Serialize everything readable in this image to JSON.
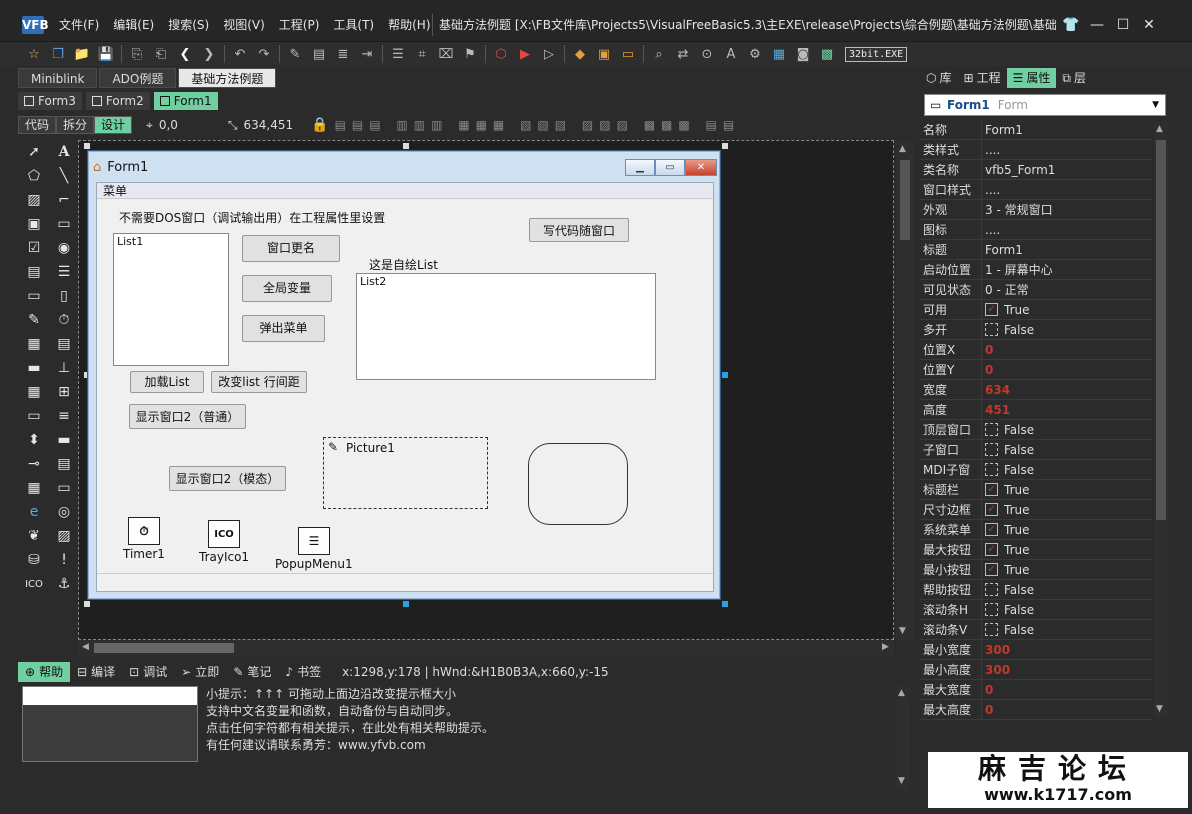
{
  "app": {
    "logo": "VFB",
    "menu": [
      "文件(F)",
      "编辑(E)",
      "搜索(S)",
      "视图(V)",
      "工程(P)",
      "工具(T)",
      "帮助(H)"
    ],
    "title": "基础方法例题 [X:\\FB文件库\\Projects5\\VisualFreeBasic5.3\\主EXE\\release\\Projects\\综合例题\\基础方法例题\\基础...",
    "controls": [
      "shirt-icon",
      "minimize",
      "maximize",
      "close"
    ]
  },
  "toolbar": {
    "bit_label": "32bit.EXE"
  },
  "doc_tabs": [
    {
      "label": "Miniblink",
      "active": false
    },
    {
      "label": "ADO例题",
      "active": false
    },
    {
      "label": "基础方法例题",
      "active": true
    }
  ],
  "form_tabs": [
    {
      "label": "Form3",
      "active": false
    },
    {
      "label": "Form2",
      "active": false
    },
    {
      "label": "Form1",
      "active": true
    }
  ],
  "design_bar": {
    "modes": [
      {
        "label": "代码",
        "active": false
      },
      {
        "label": "拆分",
        "active": false
      },
      {
        "label": "设计",
        "active": true
      }
    ],
    "position": "0,0",
    "size": "634,451"
  },
  "form": {
    "title": "Form1",
    "menu": "菜单",
    "hint_label": "不需要DOS窗口（调试输出用）在工程属性里设置",
    "btn_follow": "写代码随窗口",
    "list1": "List1",
    "btn_rename": "窗口更名",
    "btn_global": "全局变量",
    "btn_popup": "弹出菜单",
    "self_draw_label": "这是自绘List",
    "list2": "List2",
    "btn_load": "加载List",
    "btn_spacing": "改变list 行间距",
    "btn_show_normal": "显示窗口2（普通）",
    "btn_show_modal": "显示窗口2（模态）",
    "picture": "Picture1",
    "timer": "Timer1",
    "trayico": "TrayIco1",
    "trayico_glyph": "ICO",
    "popupmenu": "PopupMenu1"
  },
  "bottom": {
    "tabs": [
      {
        "label": "帮助",
        "active": true
      },
      {
        "label": "编译",
        "active": false
      },
      {
        "label": "调试",
        "active": false
      },
      {
        "label": "立即",
        "active": false
      },
      {
        "label": "笔记",
        "active": false
      },
      {
        "label": "书签",
        "active": false
      }
    ],
    "status": "x:1298,y:178 | hWnd:&H1B0B3A,x:660,y:-15",
    "help_lines": [
      "小提示：↑↑↑ 可拖动上面边沿改变提示框大小",
      "支持中文名变量和函数，自动备份与自动同步。",
      "点击任何字符都有相关提示，在此处有相关帮助提示。",
      "有任何建议请联系勇芳：www.yfvb.com"
    ]
  },
  "right_panel": {
    "tabs": [
      {
        "label": "库",
        "active": false
      },
      {
        "label": "工程",
        "active": false
      },
      {
        "label": "属性",
        "active": true
      },
      {
        "label": "层",
        "active": false
      }
    ],
    "object_name": "Form1",
    "object_class": "Form",
    "properties": [
      {
        "name": "名称",
        "value": "Form1",
        "kind": "text"
      },
      {
        "name": "类样式",
        "value": "....",
        "kind": "text"
      },
      {
        "name": "类名称",
        "value": "vfb5_Form1",
        "kind": "text"
      },
      {
        "name": "窗口样式",
        "value": "....",
        "kind": "text"
      },
      {
        "name": "外观",
        "value": "3 - 常规窗口",
        "kind": "text"
      },
      {
        "name": "图标",
        "value": "....",
        "kind": "text"
      },
      {
        "name": "标题",
        "value": "Form1",
        "kind": "text"
      },
      {
        "name": "启动位置",
        "value": "1 - 屏幕中心",
        "kind": "text"
      },
      {
        "name": "可见状态",
        "value": "0 - 正常",
        "kind": "text"
      },
      {
        "name": "可用",
        "value": "True",
        "kind": "check"
      },
      {
        "name": "多开",
        "value": "False",
        "kind": "uncheck"
      },
      {
        "name": "位置X",
        "value": "0",
        "kind": "red"
      },
      {
        "name": "位置Y",
        "value": "0",
        "kind": "red"
      },
      {
        "name": "宽度",
        "value": "634",
        "kind": "red"
      },
      {
        "name": "高度",
        "value": "451",
        "kind": "red"
      },
      {
        "name": "顶层窗口",
        "value": "False",
        "kind": "uncheck"
      },
      {
        "name": "子窗口",
        "value": "False",
        "kind": "uncheck"
      },
      {
        "name": "MDI子窗",
        "value": "False",
        "kind": "uncheck"
      },
      {
        "name": "标题栏",
        "value": "True",
        "kind": "check"
      },
      {
        "name": "尺寸边框",
        "value": "True",
        "kind": "check"
      },
      {
        "name": "系统菜单",
        "value": "True",
        "kind": "check"
      },
      {
        "name": "最大按钮",
        "value": "True",
        "kind": "check"
      },
      {
        "name": "最小按钮",
        "value": "True",
        "kind": "check"
      },
      {
        "name": "帮助按钮",
        "value": "False",
        "kind": "uncheck"
      },
      {
        "name": "滚动条H",
        "value": "False",
        "kind": "uncheck"
      },
      {
        "name": "滚动条V",
        "value": "False",
        "kind": "uncheck"
      },
      {
        "name": "最小宽度",
        "value": "300",
        "kind": "red"
      },
      {
        "name": "最小高度",
        "value": "300",
        "kind": "red"
      },
      {
        "name": "最大宽度",
        "value": "0",
        "kind": "red"
      },
      {
        "name": "最大高度",
        "value": "0",
        "kind": "red"
      }
    ]
  },
  "watermark": {
    "line1": "麻吉论坛",
    "line2": "www.k1717.com"
  },
  "colors": {
    "accent": "#6fcfa0",
    "background": "#2b2b2b",
    "red_value": "#c0392b"
  }
}
